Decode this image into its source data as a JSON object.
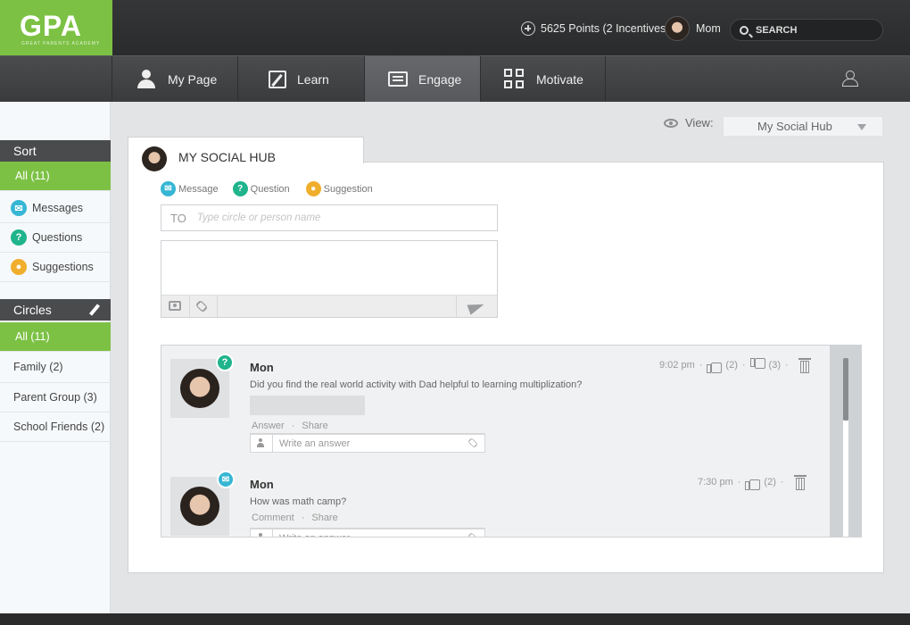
{
  "brand": {
    "logo": "GPA",
    "tagline": "GREAT PARENTS ACADEMY"
  },
  "header": {
    "points_text": "5625 Points (2 Incentives)",
    "username": "Mom",
    "search_placeholder": "SEARCH"
  },
  "nav": {
    "items": [
      {
        "label": "My Page",
        "icon": "person-icon"
      },
      {
        "label": "Learn",
        "icon": "edit-icon"
      },
      {
        "label": "Engage",
        "icon": "chat-icon",
        "active": true
      },
      {
        "label": "Motivate",
        "icon": "grid-icon"
      }
    ]
  },
  "sidebar": {
    "sort_title": "Sort",
    "sort_items": [
      {
        "label": "All (11)"
      },
      {
        "label": "Messages",
        "icon": "message-icon"
      },
      {
        "label": "Questions",
        "icon": "question-icon"
      },
      {
        "label": "Suggestions",
        "icon": "suggestion-icon"
      }
    ],
    "circles_title": "Circles",
    "circle_items": [
      {
        "label": "All  (11)"
      },
      {
        "label": "Family (2)"
      },
      {
        "label": "Parent Group (3)"
      },
      {
        "label": "School Friends (2)"
      }
    ]
  },
  "view": {
    "label": "View:",
    "selected": "My Social Hub"
  },
  "hub": {
    "title": "MY SOCIAL HUB",
    "types": [
      "Message",
      "Question",
      "Suggestion"
    ],
    "to_label": "TO",
    "to_placeholder": "Type circle or person name"
  },
  "posts": [
    {
      "author": "Mon",
      "text": "Did you find the real world activity with Dad helpful to learning multiplization?",
      "time": "9:02 pm",
      "likes": "(2)",
      "dislikes": "(3)",
      "type": "question",
      "actions": [
        "Answer",
        "Share"
      ],
      "answer_placeholder": "Write an answer"
    },
    {
      "author": "Mon",
      "text": "How was math camp?",
      "time": "7:30 pm",
      "likes": "(2)",
      "type": "message",
      "actions": [
        "Comment",
        "Share"
      ],
      "answer_placeholder": "Write an answer"
    }
  ],
  "symbols": {
    "question": "?",
    "separator": "·"
  },
  "colors": {
    "brand_green": "#7cc144",
    "message": "#36b6d4",
    "question": "#1fb48b",
    "suggestion": "#f0ae2d"
  }
}
